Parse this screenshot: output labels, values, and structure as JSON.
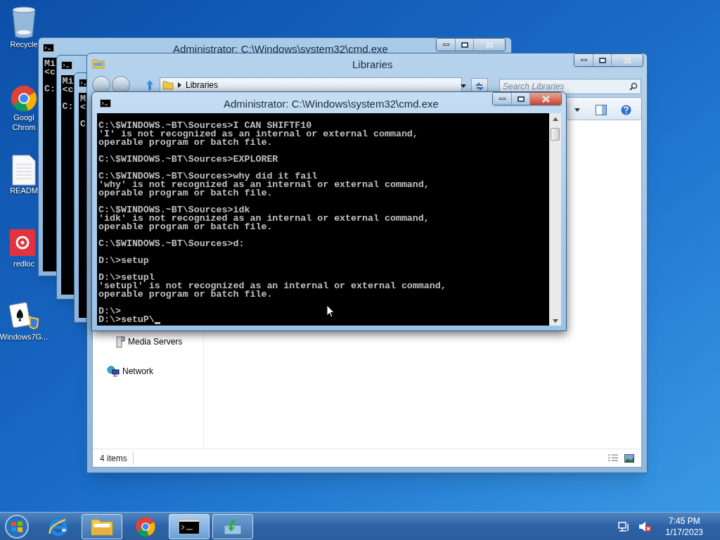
{
  "desktop_icons": [
    {
      "kind": "recycle",
      "label": "Recycle"
    },
    {
      "kind": "browser",
      "label": "Googl Chrom"
    },
    {
      "kind": "document",
      "label": "READM"
    },
    {
      "kind": "app",
      "label": "redloc"
    },
    {
      "kind": "game",
      "label": "Windows7G..."
    }
  ],
  "background_consoles": [
    {
      "title": "Administrator: C:\\Windows\\system32\\cmd.exe",
      "blocks": [
        [
          "Mi",
          "<c"
        ],
        [
          "C:"
        ]
      ]
    },
    {
      "blocks": [
        [
          "Mi",
          "<c"
        ],
        [
          "C:"
        ]
      ]
    },
    {
      "blocks": [
        [
          "M",
          "<"
        ],
        [
          "C"
        ]
      ]
    }
  ],
  "explorer": {
    "title": "Libraries",
    "address": "Libraries",
    "search_placeholder": "Search Libraries",
    "nav_items": [
      {
        "kind": "media",
        "label": "Media Servers"
      },
      {
        "kind": "network",
        "label": "Network"
      }
    ],
    "status": "4 items"
  },
  "console": {
    "title": "Administrator: C:\\Windows\\system32\\cmd.exe",
    "blocks": [
      [
        "C:\\$WINDOWS.~BT\\Sources>I CAN SHIFTF10",
        "'I' is not recognized as an internal or external command,",
        "operable program or batch file."
      ],
      [
        "C:\\$WINDOWS.~BT\\Sources>EXPLORER"
      ],
      [
        "C:\\$WINDOWS.~BT\\Sources>why did it fail",
        "'why' is not recognized as an internal or external command,",
        "operable program or batch file."
      ],
      [
        "C:\\$WINDOWS.~BT\\Sources>idk",
        "'idk' is not recognized as an internal or external command,",
        "operable program or batch file."
      ],
      [
        "C:\\$WINDOWS.~BT\\Sources>d:"
      ],
      [
        "D:\\>setup"
      ],
      [
        "D:\\>setupl",
        "'setupl' is not recognized as an internal or external command,",
        "operable program or batch file."
      ],
      [
        "D:\\>",
        "D:\\>setuP\\"
      ]
    ]
  },
  "taskbar": {
    "items": [
      {
        "kind": "ie",
        "running": false,
        "selected": false
      },
      {
        "kind": "folder",
        "running": true,
        "selected": false
      },
      {
        "kind": "chrome",
        "running": false,
        "selected": false
      },
      {
        "kind": "console",
        "running": true,
        "selected": true
      },
      {
        "kind": "installer",
        "running": true,
        "selected": false
      }
    ],
    "tray": {
      "muted": true
    },
    "clock": {
      "time": "7:45 PM",
      "date": "1/17/2023"
    }
  }
}
